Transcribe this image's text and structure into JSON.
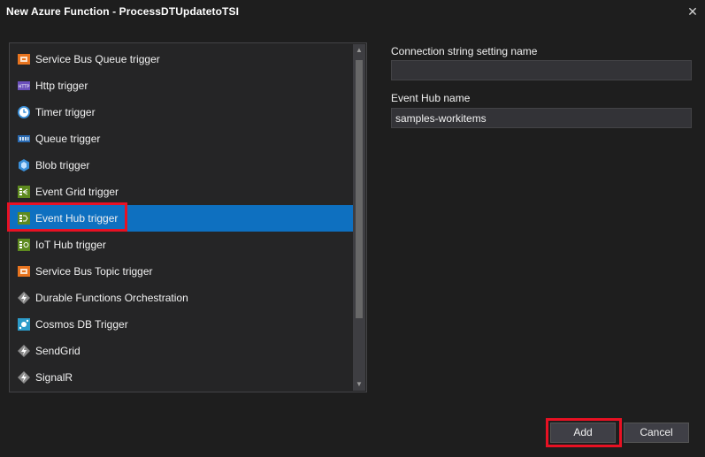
{
  "window": {
    "title": "New Azure Function -  ProcessDTUpdatetoTSI",
    "close_glyph": "✕"
  },
  "triggers": [
    {
      "label": "Service Bus Queue trigger",
      "icon": "service-bus-icon"
    },
    {
      "label": "Http trigger",
      "icon": "http-icon"
    },
    {
      "label": "Timer trigger",
      "icon": "clock-icon"
    },
    {
      "label": "Queue trigger",
      "icon": "queue-icon"
    },
    {
      "label": "Blob trigger",
      "icon": "blob-icon"
    },
    {
      "label": "Event Grid trigger",
      "icon": "event-grid-icon"
    },
    {
      "label": "Event Hub trigger",
      "icon": "event-hub-icon",
      "selected": true
    },
    {
      "label": "IoT Hub trigger",
      "icon": "iot-hub-icon"
    },
    {
      "label": "Service Bus Topic trigger",
      "icon": "service-bus-icon"
    },
    {
      "label": "Durable Functions Orchestration",
      "icon": "function-icon"
    },
    {
      "label": "Cosmos DB Trigger",
      "icon": "cosmos-db-icon"
    },
    {
      "label": "SendGrid",
      "icon": "function-icon"
    },
    {
      "label": "SignalR",
      "icon": "function-icon"
    }
  ],
  "form": {
    "connection_label": "Connection string setting name",
    "connection_value": "",
    "eventhub_label": "Event Hub name",
    "eventhub_value": "samples-workitems"
  },
  "buttons": {
    "add": "Add",
    "cancel": "Cancel"
  },
  "colors": {
    "selected": "#0e70c0",
    "highlight": "#e81123"
  }
}
